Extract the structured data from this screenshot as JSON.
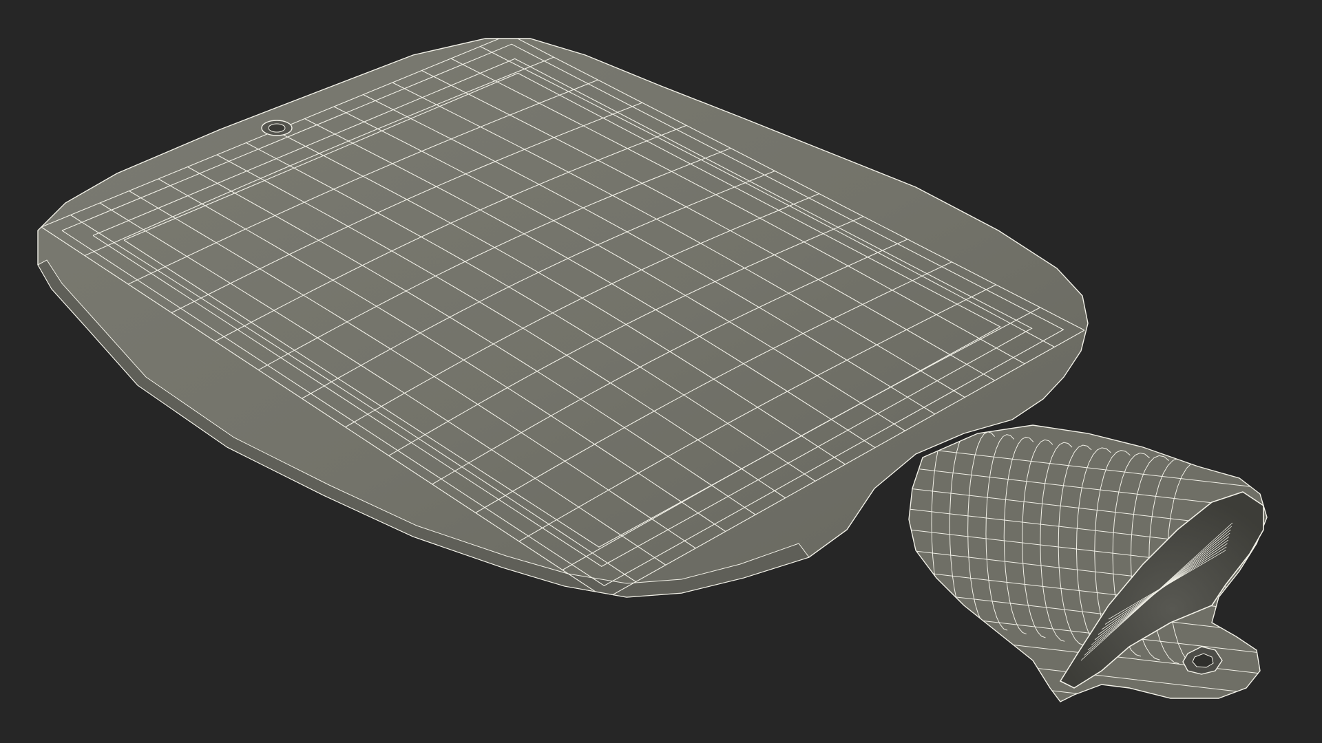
{
  "scene": {
    "background_color": "#262626",
    "model": {
      "subject": "hot-water-bottle",
      "render_style": "wireframe-on-shaded",
      "surface_color": "#73736A",
      "shadow_color": "#5E5E56",
      "inner_neck_color": "#4A4A44",
      "wire_color": "#F2F1E8"
    }
  }
}
